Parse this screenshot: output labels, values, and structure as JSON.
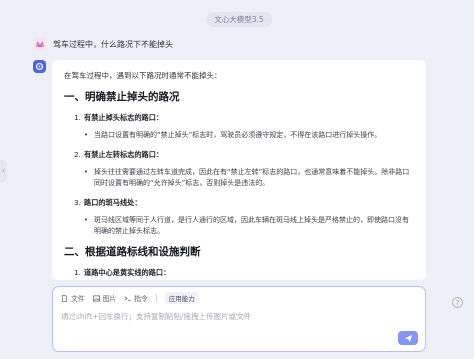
{
  "header": {
    "model_label": "文心大模型3.5"
  },
  "user_message": {
    "text": "驾车过程中，什么路况下不能掉头"
  },
  "answer": {
    "intro": "在驾车过程中，遇到以下路况时通常不能掉头：",
    "section1": {
      "heading": "一、明确禁止掉头的路况",
      "items": [
        {
          "number": "1.",
          "title": "有禁止掉头标志的路口：",
          "bullet": "当路口设置有明确的“禁止掉头”标志时，驾驶员必须遵守规定，不得在该路口进行掉头操作。"
        },
        {
          "number": "2.",
          "title": "有禁止左转标志的路口：",
          "bullet": "掉头往往需要通过左转车道完成，因此在有“禁止左转”标志的路口，也通常意味着不能掉头。除非路口同时设置有明确的“允许掉头”标志，否则掉头是违法的。"
        },
        {
          "number": "3.",
          "title": "路口的斑马线处：",
          "bullet": "斑马线区域等同于人行道，是行人通行的区域，因此车辆在斑马线上掉头是严格禁止的，即使路口没有明确的禁止掉头标志。"
        }
      ]
    },
    "section2": {
      "heading": "二、根据道路标线和设施判断",
      "items": [
        {
          "number": "1.",
          "title": "道路中心是黄实线的路口："
        }
      ]
    }
  },
  "input": {
    "toolbar": {
      "file_label": "文件",
      "image_label": "图片",
      "command_label": "指令",
      "ability_label": "应用能力"
    },
    "placeholder": "通过shift+回车换行；支持复制粘贴/拖拽上传图片或文件"
  },
  "colors": {
    "accent": "#4d63e8",
    "send": "#8396f5",
    "input_border": "#b7c0f5",
    "background": "#eef0f8"
  },
  "icons": [
    "collapse-arrow-icon",
    "user-avatar-icon",
    "bot-logo-icon",
    "file-icon",
    "image-icon",
    "command-icon",
    "send-icon",
    "help-icon"
  ]
}
